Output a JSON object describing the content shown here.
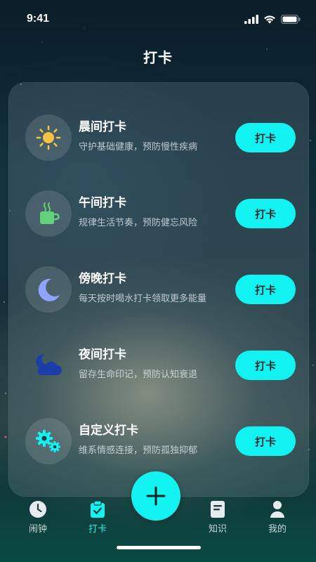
{
  "status_bar": {
    "time": "9:41"
  },
  "page": {
    "title": "打卡"
  },
  "checkins": [
    {
      "title": "晨间打卡",
      "subtitle": "守护基础健康，预防慢性疾病",
      "button": "打卡",
      "icon": "sun-icon"
    },
    {
      "title": "午间打卡",
      "subtitle": "规律生活节奏，预防健忘风险",
      "button": "打卡",
      "icon": "tea-cup-icon"
    },
    {
      "title": "傍晚打卡",
      "subtitle": "每天按时喝水打卡领取更多能量",
      "button": "打卡",
      "icon": "moon-icon"
    },
    {
      "title": "夜间打卡",
      "subtitle": "留存生命印记，预防认知衰退",
      "button": "打卡",
      "icon": "night-cloud-icon"
    },
    {
      "title": "自定义打卡",
      "subtitle": "维系情感连接，预防孤独抑郁",
      "button": "打卡",
      "icon": "gears-icon"
    }
  ],
  "tab_bar": {
    "tabs": [
      {
        "label": "闹钟",
        "icon": "clock-icon",
        "active": false
      },
      {
        "label": "打卡",
        "icon": "checkin-icon",
        "active": true
      },
      {
        "label": "知识",
        "icon": "book-icon",
        "active": false
      },
      {
        "label": "我的",
        "icon": "person-icon",
        "active": false
      }
    ],
    "fab_icon": "plus-icon"
  },
  "colors": {
    "accent": "#12f2f0",
    "button_text": "#0d2a2c"
  }
}
